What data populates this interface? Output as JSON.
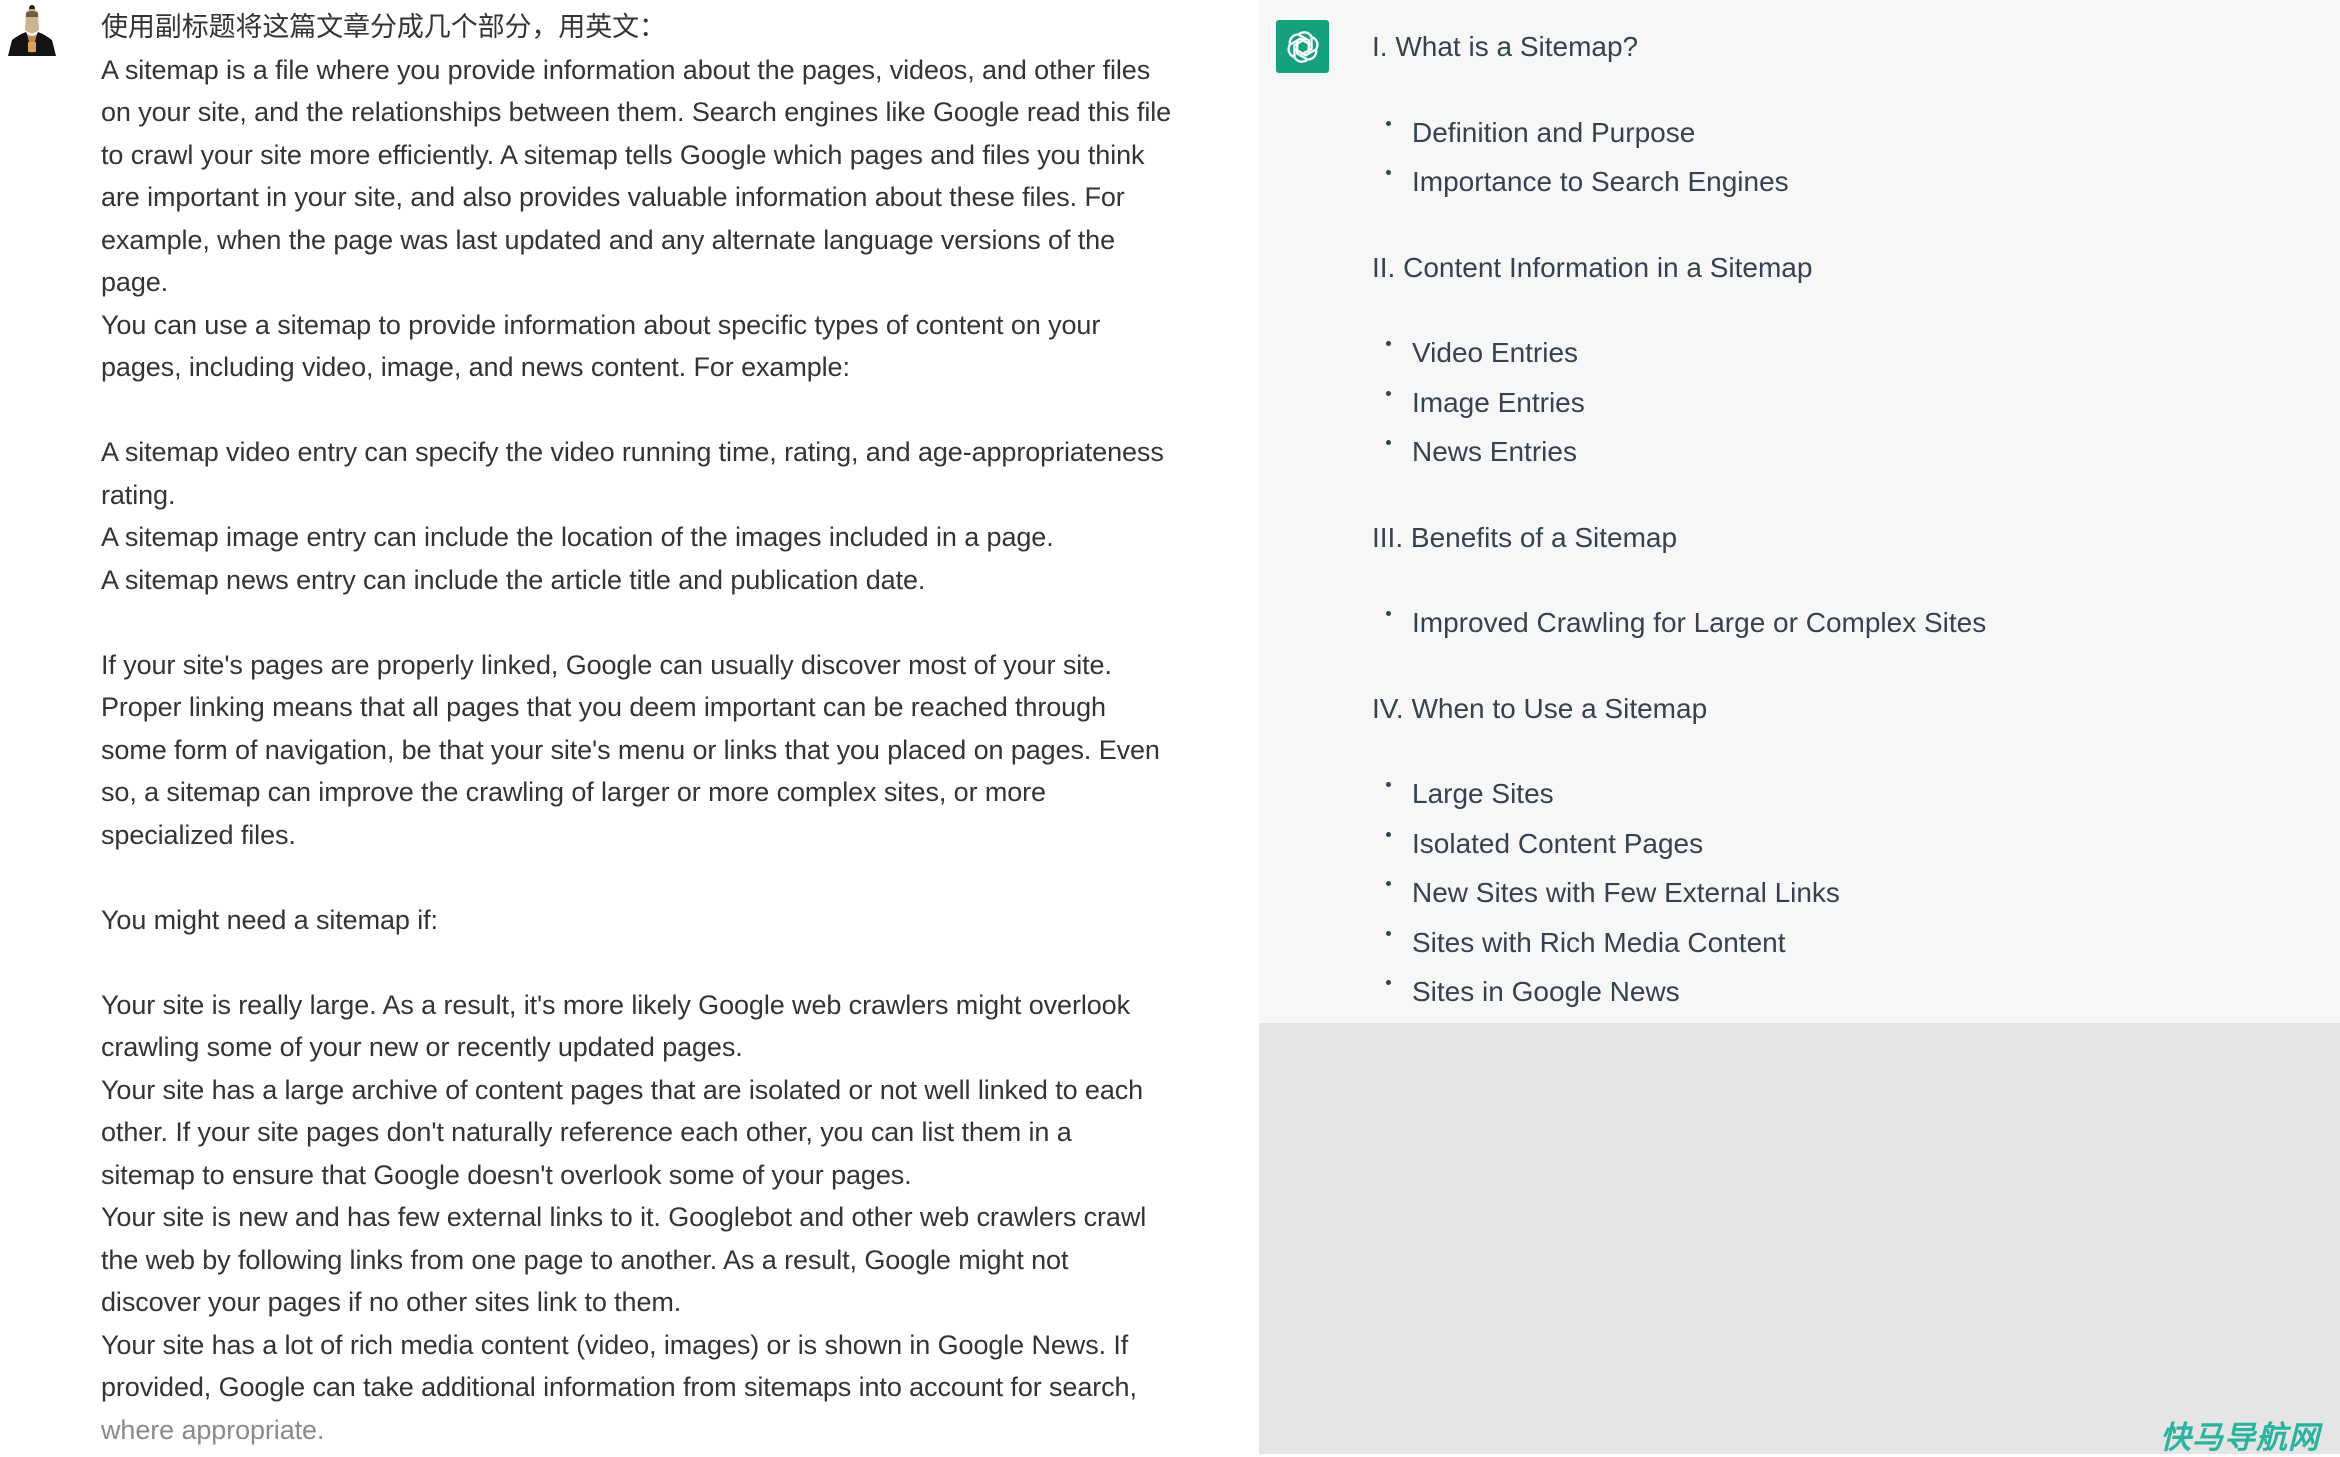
{
  "user_message": {
    "lines": [
      {
        "text": "使用副标题将这篇文章分成几个部分，用英文：",
        "faded": false
      },
      {
        "text": "A sitemap is a file where you provide information about the pages, videos, and other files",
        "faded": false
      },
      {
        "text": "on your site, and the relationships between them. Search engines like Google read this file",
        "faded": false
      },
      {
        "text": "to crawl your site more efficiently. A sitemap tells Google which pages and files you think",
        "faded": false
      },
      {
        "text": "are important in your site, and also provides valuable information about these files. For",
        "faded": false
      },
      {
        "text": "example, when the page was last updated and any alternate language versions of the",
        "faded": false
      },
      {
        "text": "page.",
        "faded": false
      },
      {
        "text": "You can use a sitemap to provide information about specific types of content on your",
        "faded": false
      },
      {
        "text": "pages, including video, image, and news content. For example:",
        "faded": false
      },
      {
        "text": "",
        "faded": false
      },
      {
        "text": "A sitemap video entry can specify the video running time, rating, and age-appropriateness",
        "faded": false
      },
      {
        "text": "rating.",
        "faded": false
      },
      {
        "text": "A sitemap image entry can include the location of the images included in a page.",
        "faded": false
      },
      {
        "text": "A sitemap news entry can include the article title and publication date.",
        "faded": false
      },
      {
        "text": "",
        "faded": false
      },
      {
        "text": "If your site's pages are properly linked, Google can usually discover most of your site.",
        "faded": false
      },
      {
        "text": "Proper linking means that all pages that you deem important can be reached through",
        "faded": false
      },
      {
        "text": "some form of navigation, be that your site's menu or links that you placed on pages. Even",
        "faded": false
      },
      {
        "text": "so, a sitemap can improve the crawling of larger or more complex sites, or more",
        "faded": false
      },
      {
        "text": "specialized files.",
        "faded": false
      },
      {
        "text": "",
        "faded": false
      },
      {
        "text": "You might need a sitemap if:",
        "faded": false
      },
      {
        "text": "",
        "faded": false
      },
      {
        "text": "Your site is really large. As a result, it's more likely Google web crawlers might overlook",
        "faded": false
      },
      {
        "text": "crawling some of your new or recently updated pages.",
        "faded": false
      },
      {
        "text": "Your site has a large archive of content pages that are isolated or not well linked to each",
        "faded": false
      },
      {
        "text": "other. If your site pages don't naturally reference each other, you can list them in a",
        "faded": false
      },
      {
        "text": "sitemap to ensure that Google doesn't overlook some of your pages.",
        "faded": false
      },
      {
        "text": "Your site is new and has few external links to it. Googlebot and other web crawlers crawl",
        "faded": false
      },
      {
        "text": "the web by following links from one page to another. As a result, Google might not",
        "faded": false
      },
      {
        "text": "discover your pages if no other sites link to them.",
        "faded": false
      },
      {
        "text": "Your site has a lot of rich media content (video, images) or is shown in Google News. If",
        "faded": false
      },
      {
        "text": "provided, Google can take additional information from sitemaps into account for search,",
        "faded": false
      },
      {
        "text": "where appropriate.",
        "faded": true
      }
    ],
    "avatar_icon": "user-avatar-figure"
  },
  "assistant_message": {
    "logo_icon": "openai-logo",
    "logo_color": "#15a17e",
    "sections": [
      {
        "heading": "I. What is a Sitemap?",
        "items": [
          "Definition and Purpose",
          "Importance to Search Engines"
        ]
      },
      {
        "heading": "II. Content Information in a Sitemap",
        "items": [
          "Video Entries",
          "Image Entries",
          "News Entries"
        ]
      },
      {
        "heading": "III. Benefits of a Sitemap",
        "items": [
          "Improved Crawling for Large or Complex Sites"
        ]
      },
      {
        "heading": "IV. When to Use a Sitemap",
        "items": [
          "Large Sites",
          "Isolated Content Pages",
          "New Sites with Few External Links",
          "Sites with Rich Media Content",
          "Sites in Google News"
        ]
      }
    ]
  },
  "watermark": {
    "text": "快马导航网",
    "color": "#2bb3a0"
  }
}
